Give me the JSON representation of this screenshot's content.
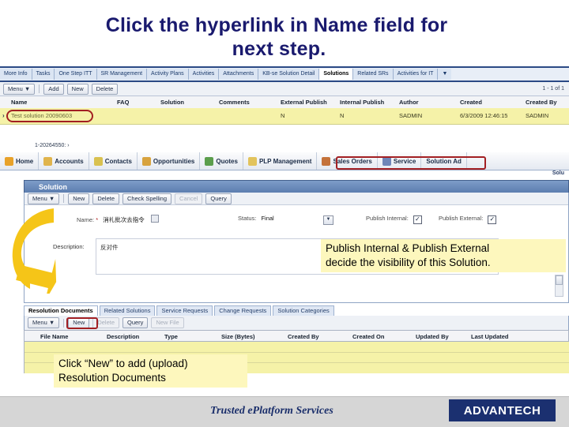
{
  "slide": {
    "title_line1": "Click the hyperlink in Name field for",
    "title_line2": "next step."
  },
  "top_tabs": {
    "items": [
      {
        "label": "More Info",
        "active": false
      },
      {
        "label": "Tasks",
        "active": false
      },
      {
        "label": "One Step ITT",
        "active": false
      },
      {
        "label": "SR Management",
        "active": false
      },
      {
        "label": "Activity Plans",
        "active": false
      },
      {
        "label": "Activities",
        "active": false
      },
      {
        "label": "Attachments",
        "active": false
      },
      {
        "label": "KB-se Solution Detail",
        "active": false
      },
      {
        "label": "Solutions",
        "active": true
      },
      {
        "label": "Related SRs",
        "active": false
      },
      {
        "label": "Activities for IT",
        "active": false
      }
    ],
    "overflow_icon": "chevron-down-icon"
  },
  "list_applet": {
    "toolbar": {
      "menu_label": "Menu",
      "menu_caret": "▼",
      "add_label": "Add",
      "new_label": "New",
      "delete_label": "Delete"
    },
    "record_count": "1 - 1 of 1",
    "columns": [
      "Name",
      "FAQ",
      "Solution",
      "Comments",
      "External Publish",
      "Internal Publish",
      "Author",
      "Created",
      "Created By"
    ],
    "rows": [
      {
        "marker": "›",
        "name": "Test solution 20090603",
        "faq": "",
        "solution": "",
        "comments": "",
        "external_publish": "N",
        "internal_publish": "N",
        "author": "SADMIN",
        "created": "6/3/2009 12:46:15",
        "created_by": "SADMIN"
      }
    ]
  },
  "breadcrumb": {
    "text": "1-20264550:",
    "separator": "›"
  },
  "navbar": {
    "items": [
      {
        "label": "Home",
        "icon": "home-icon"
      },
      {
        "label": "Accounts",
        "icon": "accounts-icon"
      },
      {
        "label": "Contacts",
        "icon": "contacts-icon"
      },
      {
        "label": "Opportunities",
        "icon": "opportunities-icon"
      },
      {
        "label": "Quotes",
        "icon": "quotes-icon"
      },
      {
        "label": "PLP Management",
        "icon": "plp-icon"
      },
      {
        "label": "Sales Orders",
        "icon": "sales-orders-icon"
      },
      {
        "label": "Service",
        "icon": "service-icon"
      },
      {
        "label": "Solution Ad",
        "icon": "solution-admin-icon"
      }
    ],
    "sub_label": "Solu"
  },
  "solution_form": {
    "title": "Solution",
    "toolbar": {
      "menu_label": "Menu",
      "menu_caret": "▼",
      "new_label": "New",
      "delete_label": "Delete",
      "check_spelling_label": "Check Spelling",
      "cancel_label": "Cancel",
      "query_label": "Query"
    },
    "fields": {
      "name_label": "Name:",
      "name_required": "*",
      "name_value": "消礼批次去指令",
      "status_label": "Status:",
      "status_value": "Final",
      "publish_internal_label": "Publish Internal:",
      "publish_internal_checked": "✓",
      "publish_external_label": "Publish External:",
      "publish_external_checked": "✓",
      "description_label": "Description:",
      "description_value": "反对件"
    }
  },
  "sub_tabs": {
    "items": [
      {
        "label": "Resolution Documents",
        "active": true
      },
      {
        "label": "Related Solutions",
        "active": false
      },
      {
        "label": "Service Requests",
        "active": false
      },
      {
        "label": "Change Requests",
        "active": false
      },
      {
        "label": "Solution Categories",
        "active": false
      }
    ]
  },
  "documents_applet": {
    "toolbar": {
      "menu_label": "Menu",
      "menu_caret": "▼",
      "new_label": "New",
      "delete_label": "Delete",
      "query_label": "Query",
      "new_file_label": "New File"
    },
    "columns": [
      "File Name",
      "Description",
      "Type",
      "Size (Bytes)",
      "Created By",
      "Created On",
      "Updated By",
      "Last Updated"
    ],
    "rows": []
  },
  "callouts": {
    "publish": "Publish Internal & Publish External\ndecide the visibility of this Solution.",
    "new_button": "Click “New” to add (upload)\nResolution Documents"
  },
  "footer": {
    "tagline": "Trusted e",
    "tagline_part2": "Platform Services",
    "logo_text": "ADVANTECH"
  },
  "colors": {
    "title_blue": "#1a1a6e",
    "highlight_red": "#a21f23",
    "row_yellow": "#f5f2a8",
    "callout_yellow": "#fdf7bd",
    "swoosh_gold": "#f5c518",
    "logo_navy": "#1b3070"
  }
}
